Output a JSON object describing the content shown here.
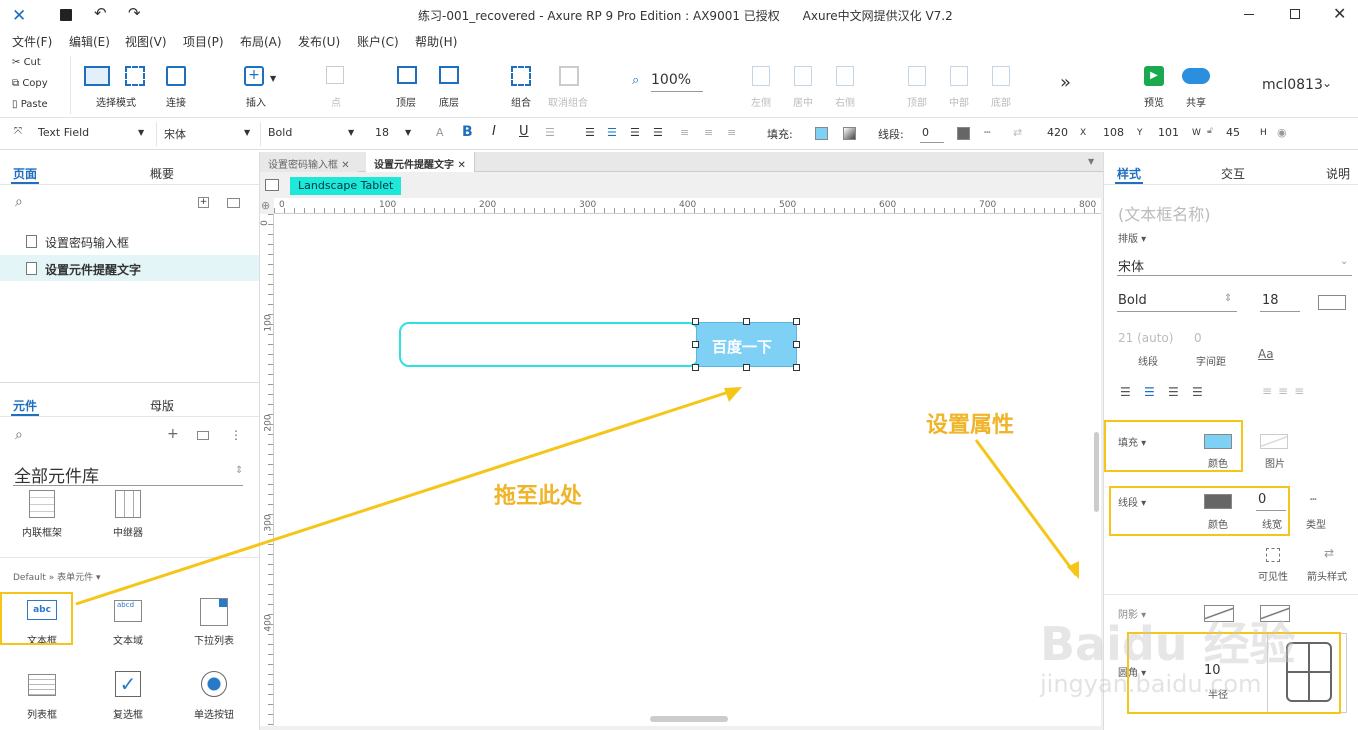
{
  "titlebar": {
    "title": "练习-001_recovered - Axure RP 9 Pro Edition : AX9001 已授权      Axure中文网提供汉化 V7.2"
  },
  "menu": [
    "文件(F)",
    "编辑(E)",
    "视图(V)",
    "项目(P)",
    "布局(A)",
    "发布(U)",
    "账户(C)",
    "帮助(H)"
  ],
  "clipboard": {
    "cut": "Cut",
    "copy": "Copy",
    "paste": "Paste"
  },
  "toolbar": {
    "select_mode": "选择模式",
    "connect": "连接",
    "insert": "插入",
    "point": "点",
    "top": "顶层",
    "bottom": "底层",
    "group": "组合",
    "ungroup": "取消组合",
    "zoom": "100%",
    "align_left": "左侧",
    "align_center": "居中",
    "align_right": "右侧",
    "align_top": "顶部",
    "align_middle": "中部",
    "align_bottom": "底部",
    "more": "»",
    "preview": "预览",
    "share": "共享",
    "user": "mcl0813"
  },
  "format": {
    "widget_type": "Text Field",
    "font": "宋体",
    "weight": "Bold",
    "size": "18",
    "fill_label": "填充:",
    "stroke_label": "线段:",
    "stroke_value": "0",
    "x": "420",
    "x_label": "X",
    "y": "108",
    "y_label": "Y",
    "w": "101",
    "w_label": "W",
    "h": "45",
    "h_label": "H"
  },
  "left": {
    "pages_tab": "页面",
    "outline_tab": "概要",
    "pages": [
      "设置密码输入框",
      "设置元件提醒文字"
    ],
    "widgets_tab": "元件",
    "masters_tab": "母版",
    "library": "全部元件库",
    "lib_items": [
      "内联框架",
      "中继器"
    ],
    "section": "Default » 表单元件 ▾",
    "form_items": [
      "文本框",
      "文本域",
      "下拉列表",
      "列表框",
      "复选框",
      "单选按钮"
    ]
  },
  "canvas": {
    "tabs": [
      "设置密码输入框",
      "设置元件提醒文字"
    ],
    "device": "Landscape Tablet",
    "ruler_h": [
      "0",
      "100",
      "200",
      "300",
      "400",
      "500",
      "600",
      "700",
      "800"
    ],
    "ruler_v": [
      "0",
      "100",
      "200",
      "300",
      "400"
    ],
    "button_text": "百度一下"
  },
  "right": {
    "style_tab": "样式",
    "interact_tab": "交互",
    "notes_tab": "说明",
    "name_placeholder": "(文本框名称)",
    "typography": "排版 ▾",
    "font": "宋体",
    "weight": "Bold",
    "size": "18",
    "line_spacing": "21 (auto)",
    "line_spacing_label": "线段",
    "char_spacing": "0",
    "char_spacing_label": "字间距",
    "fill": "填充 ▾",
    "fill_color": "颜色",
    "fill_image": "图片",
    "stroke": "线段 ▾",
    "stroke_color": "颜色",
    "stroke_width": "0",
    "stroke_width_label": "线宽",
    "stroke_type": "类型",
    "visibility": "可见性",
    "arrow": "箭头样式",
    "shadow": "阴影 ▾",
    "radius": "圆角 ▾",
    "radius_value": "10",
    "radius_label": "半径"
  },
  "annotations": {
    "drag_here": "拖至此处",
    "set_props": "设置属性"
  },
  "watermark": {
    "brand": "Baidu 经验",
    "url": "jingyan.baidu.com"
  },
  "colors": {
    "accent": "#1e6fbf",
    "annotation": "#f5c518",
    "button_fill": "#7fd0f5",
    "field_border": "#2ee0e0",
    "device_badge": "#1de9d9"
  }
}
